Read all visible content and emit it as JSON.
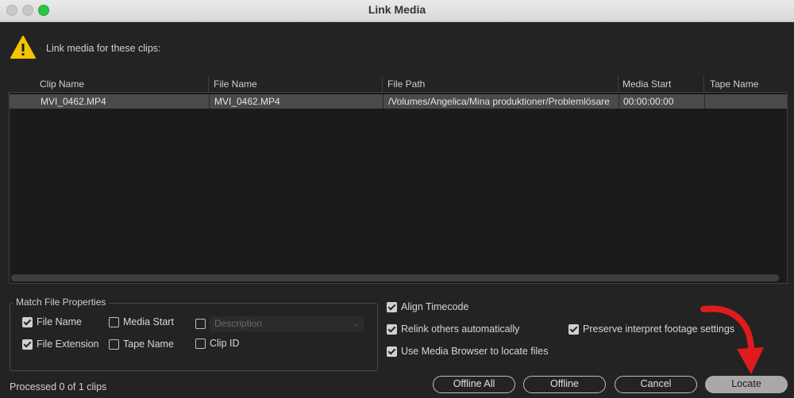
{
  "window": {
    "title": "Link Media"
  },
  "header": {
    "message": "Link media for these clips:"
  },
  "table": {
    "columns": [
      "Clip Name",
      "File Name",
      "File Path",
      "Media Start",
      "Tape Name"
    ],
    "rows": [
      [
        "MVI_0462.MP4",
        "MVI_0462.MP4",
        "/Volumes/Angelica/Mina produktioner/Problemlösare",
        "00:00:00:00",
        ""
      ]
    ]
  },
  "match": {
    "title": "Match File Properties",
    "file_name": {
      "label": "File Name",
      "checked": true
    },
    "file_extension": {
      "label": "File Extension",
      "checked": true
    },
    "media_start": {
      "label": "Media Start",
      "checked": false
    },
    "tape_name": {
      "label": "Tape Name",
      "checked": false
    },
    "description": {
      "label": "Description",
      "checked": false
    },
    "clip_id": {
      "label": "Clip ID",
      "checked": false
    }
  },
  "options": {
    "align_timecode": {
      "label": "Align Timecode",
      "checked": true
    },
    "relink_others": {
      "label": "Relink others automatically",
      "checked": true
    },
    "preserve_interpret": {
      "label": "Preserve interpret footage settings",
      "checked": true
    },
    "use_media_browser": {
      "label": "Use Media Browser to locate files",
      "checked": true
    }
  },
  "status": "Processed 0 of 1 clips",
  "buttons": {
    "offline_all": "Offline All",
    "offline": "Offline",
    "cancel": "Cancel",
    "locate": "Locate"
  },
  "colors": {
    "warning": "#f5c400",
    "annotation_arrow": "#e01b1b"
  }
}
